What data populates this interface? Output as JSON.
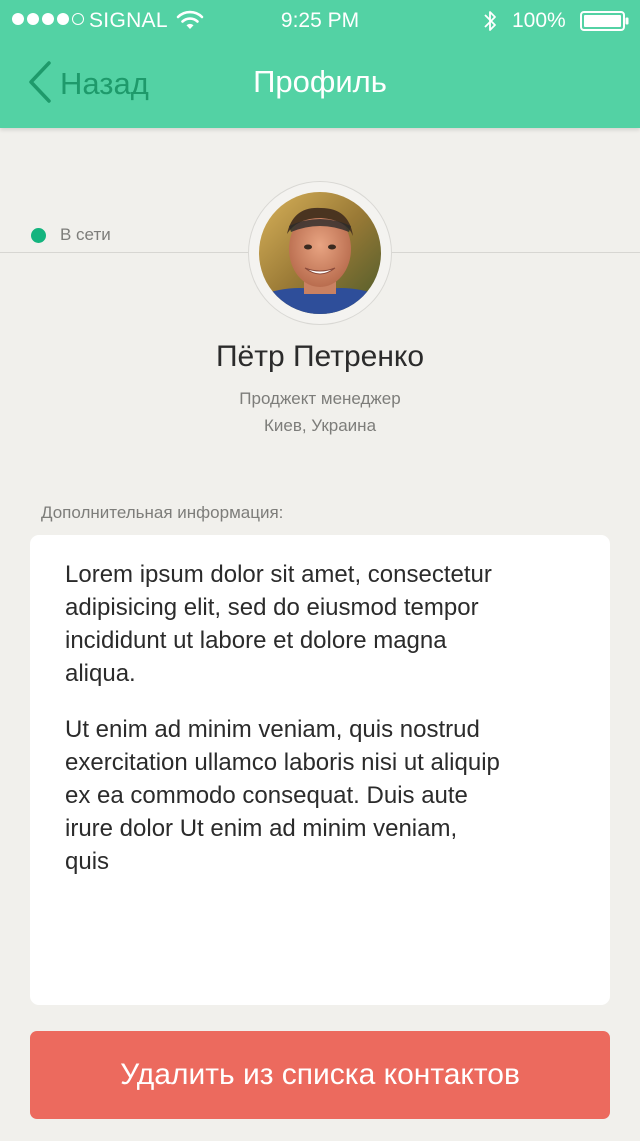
{
  "status_bar": {
    "carrier": "SIGNAL",
    "time": "9:25 PM",
    "battery": "100%"
  },
  "nav": {
    "back_label": "Назад",
    "title": "Профиль"
  },
  "profile": {
    "status_label": "В сети",
    "name": "Пётр Петренко",
    "role": "Проджект менеджер",
    "location": "Киев, Украина"
  },
  "info": {
    "label": "Дополнительная информация:",
    "paragraph1": "Lorem ipsum dolor sit amet, consectetur adipisicing elit, sed do eiusmod tempor incididunt ut labore et dolore magna aliqua.",
    "paragraph2": "Ut enim ad minim veniam, quis nostrud exercitation ullamco laboris nisi ut aliquip ex ea commodo consequat. Duis aute irure dolor Ut enim ad minim veniam, quis"
  },
  "actions": {
    "delete_label": "Удалить из списка контактов"
  },
  "colors": {
    "header": "#53d2a4",
    "back_accent": "#1e9a6b",
    "online": "#14b47e",
    "delete": "#ec6a5e"
  },
  "icons": {
    "signal": "signal-dots-icon",
    "wifi": "wifi-icon",
    "bluetooth": "bluetooth-icon",
    "battery": "battery-icon",
    "back": "chevron-left-icon"
  }
}
